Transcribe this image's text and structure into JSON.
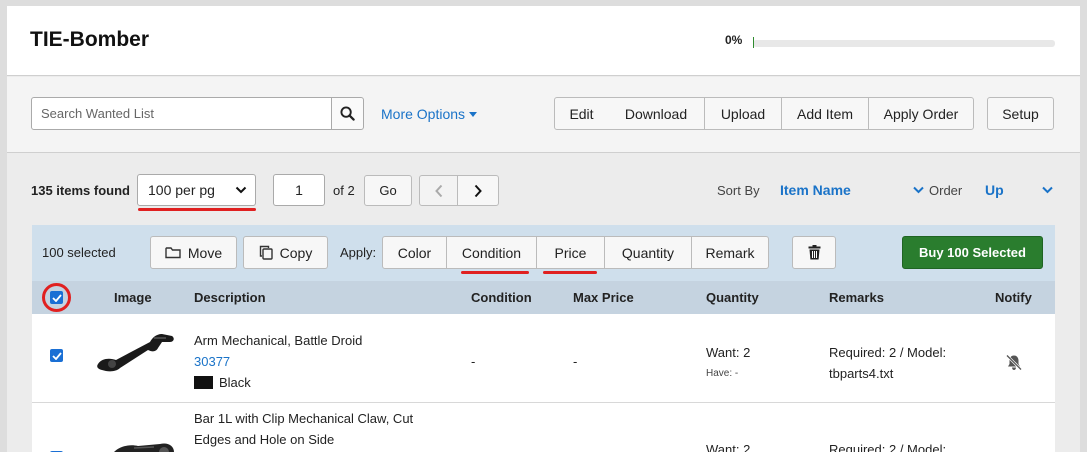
{
  "header": {
    "title": "TIE-Bomber",
    "progress_label": "0%",
    "progress_value": 0
  },
  "toolbar": {
    "search_placeholder": "Search Wanted List",
    "more_options": "More Options",
    "buttons": {
      "edit": "Edit",
      "download": "Download",
      "upload": "Upload",
      "add_item": "Add Item",
      "apply_order": "Apply Order",
      "setup": "Setup"
    }
  },
  "pager": {
    "items_found": "135 items found",
    "per_page": "100 per pg",
    "page": "1",
    "of": "of 2",
    "go": "Go",
    "sort_by_label": "Sort By",
    "sort_by_value": "Item Name",
    "order_label": "Order",
    "order_value": "Up"
  },
  "selection": {
    "count": "100 selected",
    "move": "Move",
    "copy": "Copy",
    "apply": "Apply:",
    "apply_buttons": {
      "color": "Color",
      "condition": "Condition",
      "price": "Price",
      "quantity": "Quantity",
      "remark": "Remark"
    },
    "buy": "Buy 100 Selected"
  },
  "table": {
    "headers": {
      "image": "Image",
      "description": "Description",
      "condition": "Condition",
      "max_price": "Max Price",
      "quantity": "Quantity",
      "remarks": "Remarks",
      "notify": "Notify"
    },
    "rows": [
      {
        "name": "Arm Mechanical, Battle Droid",
        "part_number": "30377",
        "color": "Black",
        "condition": "-",
        "max_price": "-",
        "want": "Want: 2",
        "have": "Have: -",
        "remark_line1": "Required: 2 / Model:",
        "remark_line2": "tbparts4.txt"
      },
      {
        "name_line1": "Bar 1L with Clip Mechanical Claw, Cut",
        "name_line2": "Edges and Hole on Side",
        "want": "Want: 2",
        "remark_line1": "Required: 2 / Model:"
      }
    ]
  },
  "colors": {
    "accent": "#1a73c8",
    "buy_green": "#2a7d2e",
    "highlight_red": "#e02020"
  }
}
